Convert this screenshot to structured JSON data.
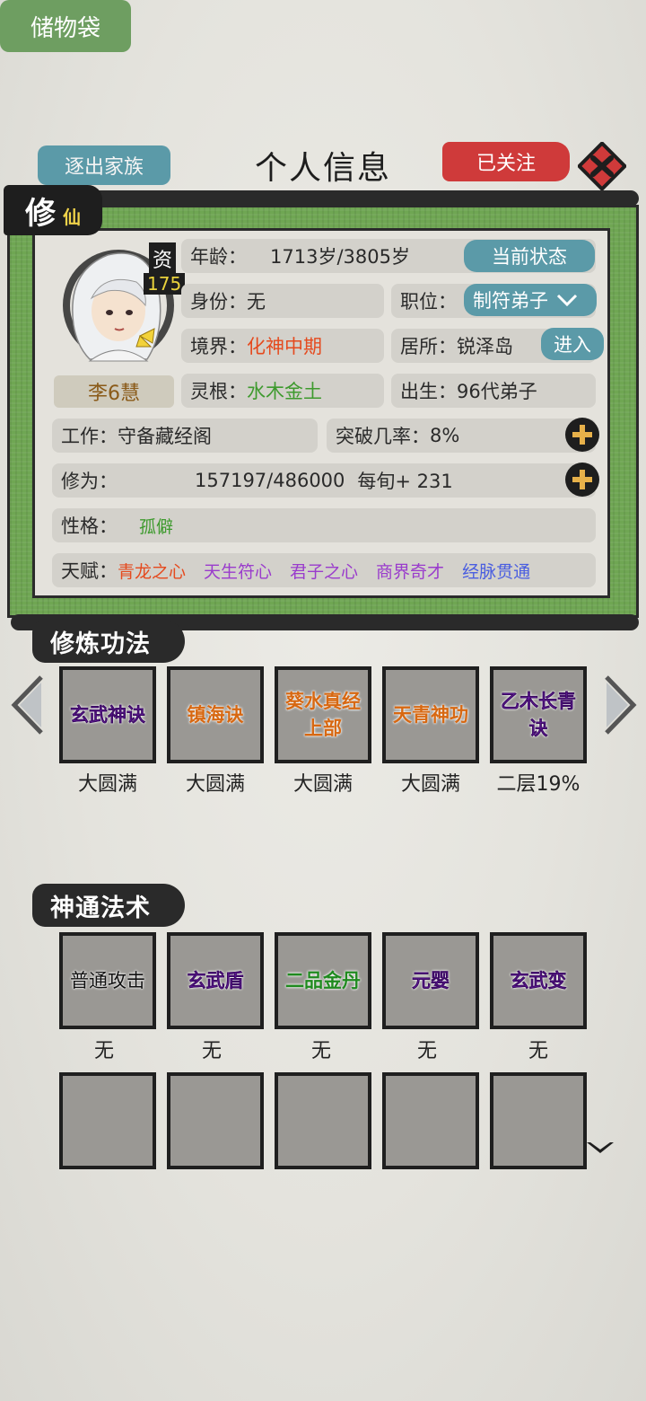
{
  "header": {
    "title": "个人信息",
    "expel_label": "逐出家族",
    "follow_label": "已关注"
  },
  "scroll": {
    "tag_main": "修",
    "tag_sub": "仙"
  },
  "profile": {
    "aptitude_label": "资",
    "aptitude_value": "175",
    "name": "李6慧",
    "age_label": "年龄：",
    "age_value": "1713岁/3805岁",
    "status_button": "当前状态",
    "identity_label": "身份：",
    "identity_value": "无",
    "position_label": "职位：",
    "position_value": "制符弟子",
    "realm_label": "境界：",
    "realm_value": "化神中期",
    "residence_label": "居所：",
    "residence_value": "锐泽岛",
    "enter_button": "进入",
    "spirit_root_label": "灵根：",
    "spirit_root_value": "水木金土",
    "birth_label": "出生：",
    "birth_value": "96代弟子",
    "work_label": "工作：",
    "work_value": "守备藏经阁",
    "breakthrough_label": "突破几率：",
    "breakthrough_value": "8%",
    "cultivation_label": "修为：",
    "cultivation_value": "157197/486000",
    "per_turn": "每旬+ 231",
    "personality_label": "性格：",
    "personality_value": "孤僻",
    "talent_label": "天赋：",
    "talents": [
      {
        "text": "青龙之心",
        "color": "#e54a1e"
      },
      {
        "text": "天生符心",
        "color": "#9a3ccc"
      },
      {
        "text": "君子之心",
        "color": "#9a3ccc"
      },
      {
        "text": "商界奇才",
        "color": "#9a3ccc"
      },
      {
        "text": "经脉贯通",
        "color": "#4a5ee0"
      }
    ]
  },
  "techniques": {
    "title": "修炼功法",
    "items": [
      {
        "name": "玄武神诀",
        "level": "大圆满",
        "color": "purple"
      },
      {
        "name": "镇海诀",
        "level": "大圆满",
        "color": "orange"
      },
      {
        "name": "葵水真经上部",
        "level": "大圆满",
        "color": "orange"
      },
      {
        "name": "天青神功",
        "level": "大圆满",
        "color": "orange"
      },
      {
        "name": "乙木长青诀",
        "level": "二层19%",
        "color": "purple"
      }
    ]
  },
  "arts": {
    "title": "神通法术",
    "items": [
      {
        "name": "普通攻击",
        "level": "无",
        "color": "black"
      },
      {
        "name": "玄武盾",
        "level": "无",
        "color": "purple"
      },
      {
        "name": "二品金丹",
        "level": "无",
        "color": "green"
      },
      {
        "name": "元婴",
        "level": "无",
        "color": "purple"
      },
      {
        "name": "玄武变",
        "level": "无",
        "color": "purple"
      }
    ]
  },
  "storage_button": "储物袋"
}
